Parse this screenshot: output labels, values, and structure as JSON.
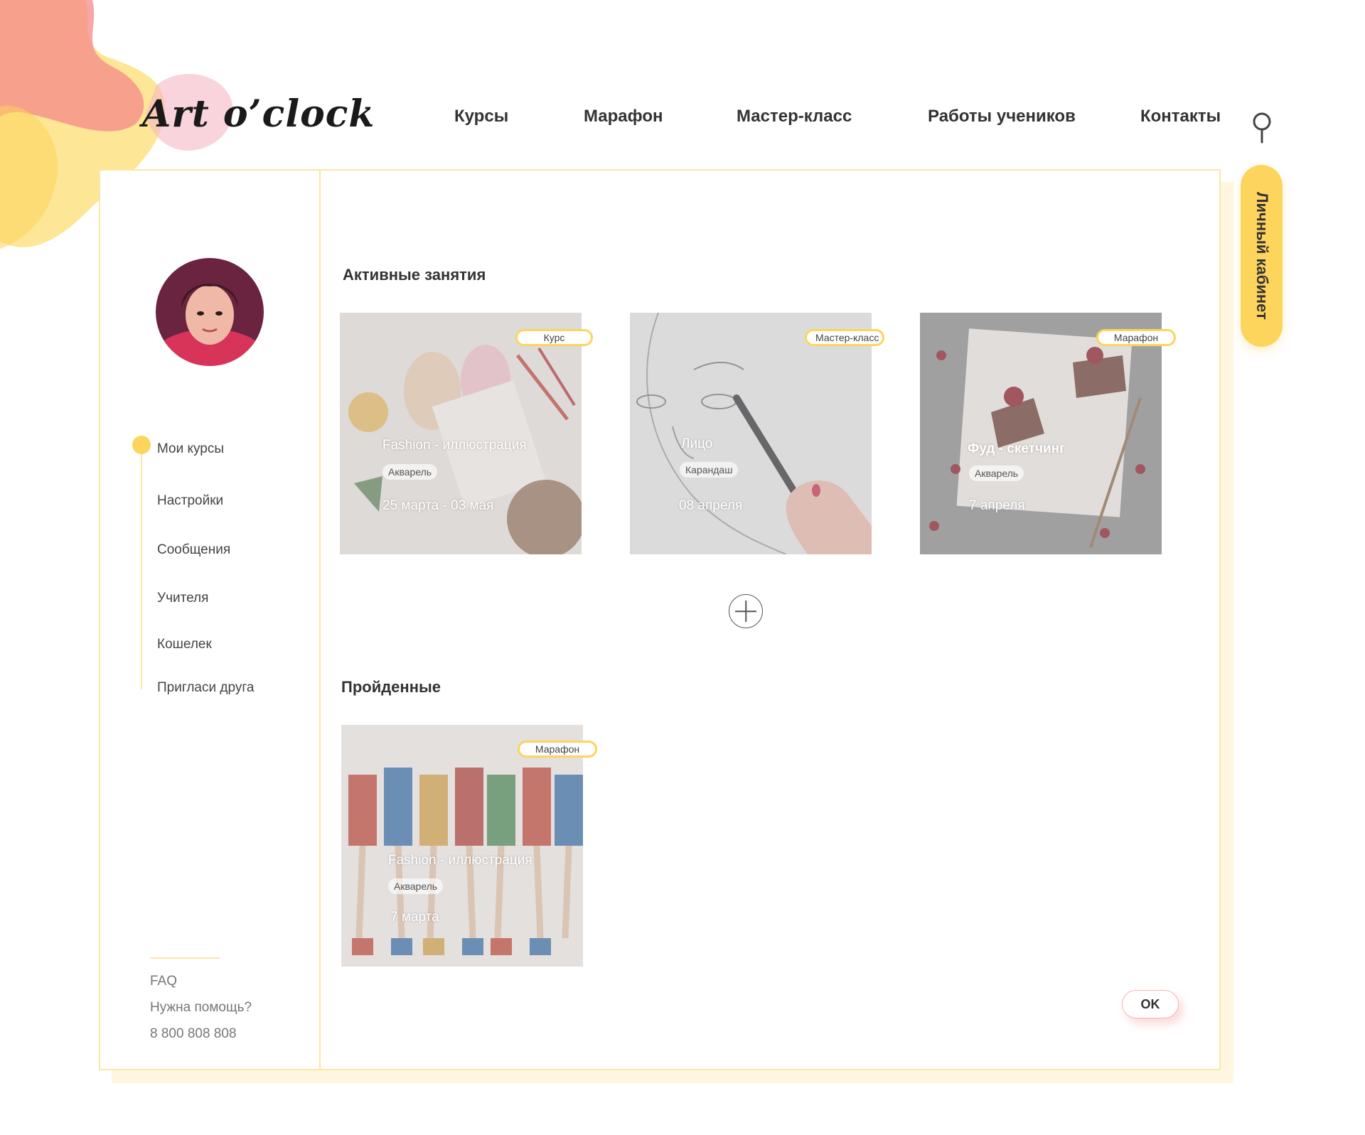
{
  "brand": {
    "logo_text": "Art o’clock"
  },
  "nav": {
    "items": [
      {
        "label": "Курсы"
      },
      {
        "label": "Марафон"
      },
      {
        "label": "Мастер-класс"
      },
      {
        "label": "Работы учеников"
      },
      {
        "label": "Контакты"
      }
    ],
    "search_icon": "search-icon"
  },
  "cabinet_tab": {
    "label": "Личный кабинет"
  },
  "sidebar": {
    "items": [
      {
        "label": "Мои курсы",
        "active": true
      },
      {
        "label": "Настройки"
      },
      {
        "label": "Сообщения"
      },
      {
        "label": "Учителя"
      },
      {
        "label": "Кошелек"
      },
      {
        "label": "Пригласи друга"
      }
    ],
    "footer": {
      "faq": "FAQ",
      "help": "Нужна помощь?",
      "phone": "8 800 808 808"
    }
  },
  "active_section": {
    "title": "Активные занятия",
    "cards": [
      {
        "tag": "Курс",
        "title": "Fashion - иллюстрация",
        "chip": "Акварель",
        "date": "25 марта - 03 мая"
      },
      {
        "tag": "Мастер-класс",
        "title": "Лицо",
        "chip": "Карандаш",
        "date": "08 апреля"
      },
      {
        "tag": "Марафон",
        "title": "Фуд - скетчинг",
        "chip": "Акварель",
        "date": "7 апреля"
      }
    ]
  },
  "completed_section": {
    "title": "Пройденные",
    "cards": [
      {
        "tag": "Марафон",
        "title": "Fashion - иллюстрация",
        "chip": "Акварель",
        "date": "7 марта"
      }
    ]
  },
  "actions": {
    "ok_label": "OK"
  },
  "colors": {
    "accent": "#fdd45c",
    "border": "#fbe7a5",
    "ok_border": "#f6b3b3"
  }
}
